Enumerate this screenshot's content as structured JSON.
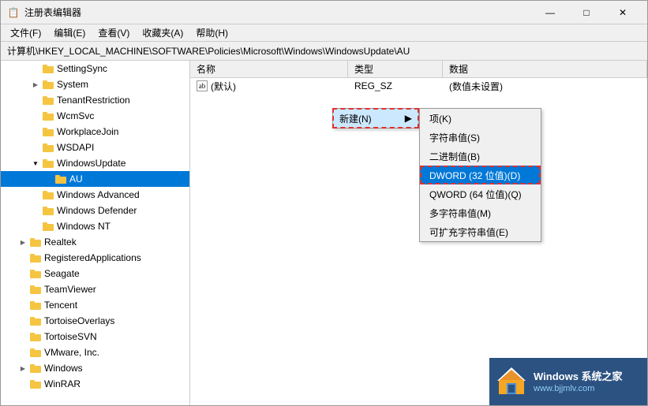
{
  "window": {
    "title": "注册表编辑器",
    "title_icon": "📋"
  },
  "title_controls": {
    "minimize": "—",
    "maximize": "□",
    "close": "✕"
  },
  "menu_bar": {
    "items": [
      {
        "label": "文件(F)"
      },
      {
        "label": "编辑(E)"
      },
      {
        "label": "查看(V)"
      },
      {
        "label": "收藏夹(A)"
      },
      {
        "label": "帮助(H)"
      }
    ]
  },
  "address_bar": {
    "prefix": "计算机\\HKEY_LOCAL_MACHINE\\SOFTWARE\\Policies\\Microsoft\\Windows\\WindowsUpdate\\AU"
  },
  "tree": {
    "items": [
      {
        "label": "SettingSync",
        "indent": 2,
        "arrow": "",
        "expanded": false
      },
      {
        "label": "System",
        "indent": 2,
        "arrow": "▶",
        "expanded": false
      },
      {
        "label": "TenantRestriction",
        "indent": 2,
        "arrow": "",
        "expanded": false
      },
      {
        "label": "WcmSvc",
        "indent": 2,
        "arrow": "",
        "expanded": false
      },
      {
        "label": "WorkplaceJoin",
        "indent": 2,
        "arrow": "",
        "expanded": false
      },
      {
        "label": "WSDAPI",
        "indent": 2,
        "arrow": "",
        "expanded": false
      },
      {
        "label": "WindowsUpdate",
        "indent": 2,
        "arrow": "▼",
        "expanded": true
      },
      {
        "label": "AU",
        "indent": 3,
        "arrow": "",
        "expanded": false,
        "selected": true
      },
      {
        "label": "Windows Advanced",
        "indent": 2,
        "arrow": "",
        "expanded": false
      },
      {
        "label": "Windows Defender",
        "indent": 2,
        "arrow": "",
        "expanded": false
      },
      {
        "label": "Windows NT",
        "indent": 2,
        "arrow": "",
        "expanded": false
      },
      {
        "label": "Realtek",
        "indent": 1,
        "arrow": "▶",
        "expanded": false
      },
      {
        "label": "RegisteredApplications",
        "indent": 1,
        "arrow": "",
        "expanded": false
      },
      {
        "label": "Seagate",
        "indent": 1,
        "arrow": "",
        "expanded": false
      },
      {
        "label": "TeamViewer",
        "indent": 1,
        "arrow": "",
        "expanded": false
      },
      {
        "label": "Tencent",
        "indent": 1,
        "arrow": "",
        "expanded": false
      },
      {
        "label": "TortoiseOverlays",
        "indent": 1,
        "arrow": "",
        "expanded": false
      },
      {
        "label": "TortoiseSVN",
        "indent": 1,
        "arrow": "",
        "expanded": false
      },
      {
        "label": "VMware, Inc.",
        "indent": 1,
        "arrow": "",
        "expanded": false
      },
      {
        "label": "Windows",
        "indent": 1,
        "arrow": "▶",
        "expanded": false
      },
      {
        "label": "WinRAR",
        "indent": 1,
        "arrow": "",
        "expanded": false
      }
    ]
  },
  "table": {
    "headers": [
      {
        "label": "名称",
        "key": "name"
      },
      {
        "label": "类型",
        "key": "type"
      },
      {
        "label": "数据",
        "key": "data"
      }
    ],
    "rows": [
      {
        "name": "(默认)",
        "type": "REG_SZ",
        "data": "(数值未设置)",
        "icon": "ab"
      }
    ]
  },
  "context_menu_new": {
    "label": "新建(N)",
    "arrow": "▶"
  },
  "submenu": {
    "items": [
      {
        "label": "项(K)",
        "highlighted": false
      },
      {
        "label": "字符串值(S)",
        "highlighted": false
      },
      {
        "label": "二进制值(B)",
        "highlighted": false
      },
      {
        "label": "DWORD (32 位值)(D)",
        "highlighted": true
      },
      {
        "label": "QWORD (64 位值)(Q)",
        "highlighted": false
      },
      {
        "label": "多字符串值(M)",
        "highlighted": false
      },
      {
        "label": "可扩充字符串值(E)",
        "highlighted": false
      }
    ]
  },
  "watermark": {
    "line1": "Windows 系统之家",
    "line2": "www.bjjmlv.com"
  }
}
